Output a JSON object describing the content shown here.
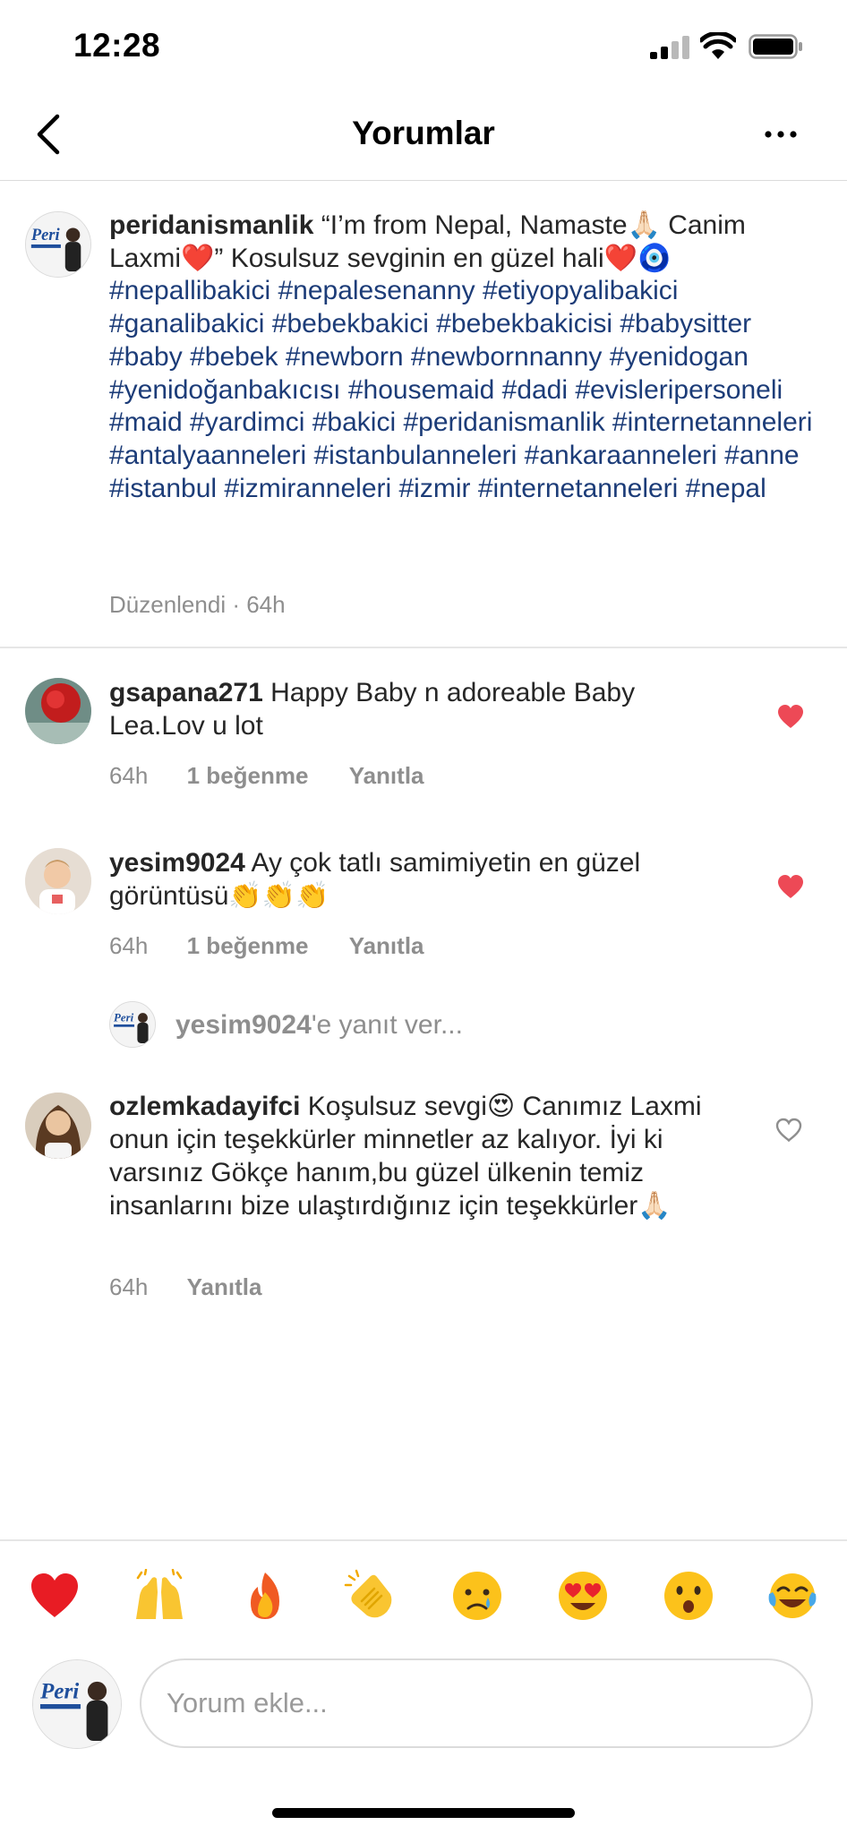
{
  "status_bar": {
    "time": "12:28"
  },
  "header": {
    "title": "Yorumlar"
  },
  "caption": {
    "username": "peridanismanlik",
    "text_part1": "“I’m from Nepal, Namaste🙏🏻 Canim Laxmi❤️” Kosulsuz sevginin en güzel hali❤️🧿",
    "hashtags": "#nepallibakici #nepalesenanny #etiyopyalibakici #ganalibakici #bebekbakici #bebekbakicisi #babysitter #baby #bebek #newborn #newbornnanny #yenidogan #yenidoğanbakıcısı #housemaid #dadi #evisleripersoneli #maid #yardimci #bakici #peridanismanlik #internetanneleri #antalyaanneleri #istanbulanneleri #ankaraanneleri #anne #istanbul #izmiranneleri #izmir #internetanneleri #nepal",
    "meta": "Düzenlendi · 64h"
  },
  "comments": [
    {
      "username": "gsapana271",
      "text": "Happy Baby n adoreable Baby Lea.Lov u lot",
      "time": "64h",
      "likes": "1 beğenme",
      "reply": "Yanıtla",
      "liked": true
    },
    {
      "username": "yesim9024",
      "text": "Ay çok tatlı samimiyetin en güzel görüntüsü👏👏👏",
      "time": "64h",
      "likes": "1 beğenme",
      "reply": "Yanıtla",
      "liked": true
    },
    {
      "username": "ozlemkadayifci",
      "text": "Koşulsuz sevgi😍 Canımız Laxmi onun için teşekkürler minnetler az kalıyor. İyi ki varsınız Gökçe hanım,bu güzel ülkenin temiz insanlarını bize ulaştırdığınız için teşekkürler🙏🏻",
      "time": "64h",
      "reply": "Yanıtla",
      "liked": false
    }
  ],
  "reply_prompt": {
    "username": "yesim9024",
    "suffix": "'e yanıt ver..."
  },
  "emoji_bar": [
    "red-heart",
    "raising-hands",
    "fire",
    "clapping-hands",
    "crying-face",
    "heart-eyes-face",
    "astonished-face",
    "tears-of-joy-face"
  ],
  "comment_input": {
    "placeholder": "Yorum ekle..."
  },
  "colors": {
    "hashtag": "#1c3c78",
    "like_red": "#ed4956",
    "muted": "#8e8e8e"
  }
}
